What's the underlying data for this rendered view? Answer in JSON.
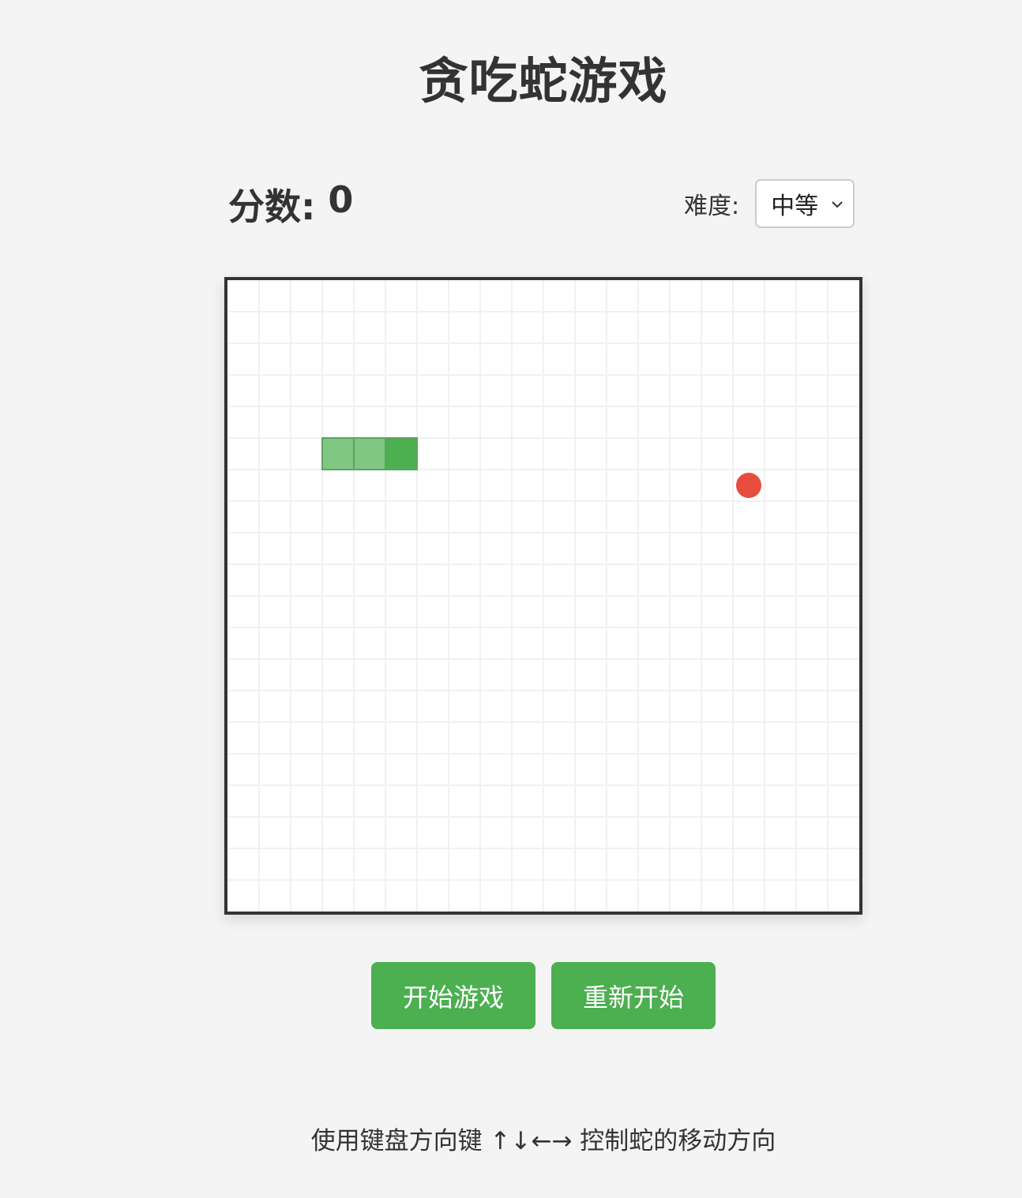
{
  "header": {
    "title": "贪吃蛇游戏"
  },
  "status": {
    "score_label": "分数: ",
    "score_value": "0"
  },
  "difficulty": {
    "label": "难度:",
    "selected": "中等"
  },
  "board": {
    "grid_cols": 20,
    "grid_rows": 20,
    "snake_cells": [
      {
        "col": 5,
        "row": 5,
        "part": "head"
      },
      {
        "col": 4,
        "row": 5,
        "part": "body"
      },
      {
        "col": 3,
        "row": 5,
        "part": "body"
      }
    ],
    "food_cell": {
      "col": 16,
      "row": 6
    },
    "colors": {
      "head": "#4caf50",
      "body": "#81c784",
      "food": "#e74c3c",
      "grid": "#f1f1f1",
      "border": "#333333"
    }
  },
  "controls": {
    "start_label": "开始游戏",
    "restart_label": "重新开始"
  },
  "footer": {
    "instructions": "使用键盘方向键 ↑↓←→ 控制蛇的移动方向"
  }
}
